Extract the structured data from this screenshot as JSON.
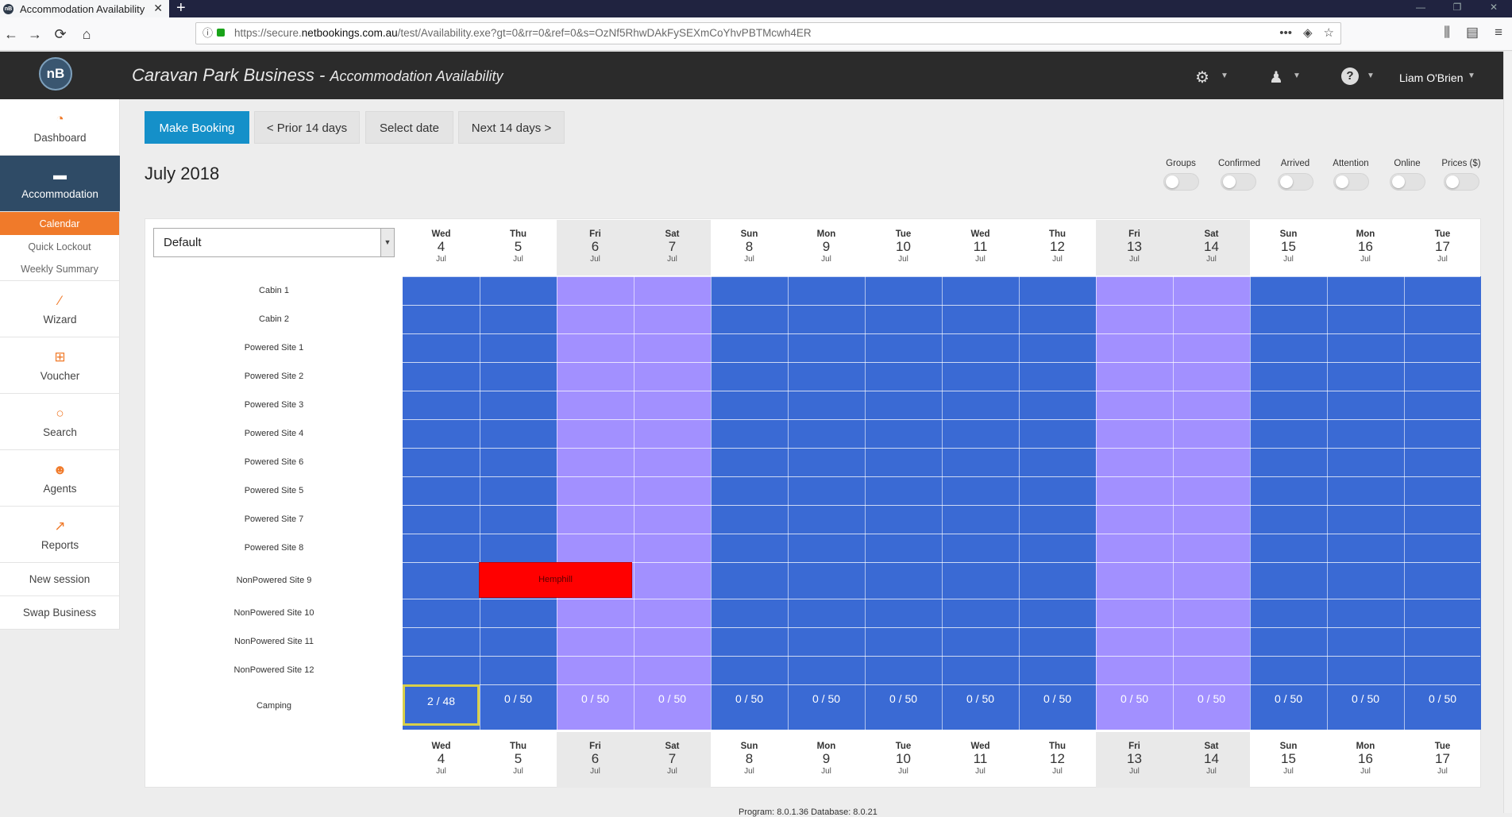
{
  "browser": {
    "tab_title": "Accommodation Availability",
    "favicon_text": "nB",
    "url_prefix": "https://secure.",
    "url_host": "netbookings.com.au",
    "url_rest": "/test/Availability.exe?gt=0&rr=0&ref=0&s=OzNf5RhwDAkFySEXmCoYhvPBTMcwh4ER"
  },
  "header": {
    "logo_text": "nB",
    "business": "Caravan Park Business",
    "separator": " - ",
    "page": "Accommodation Availability",
    "user": "Liam O'Brien"
  },
  "sidebar": {
    "dashboard": "Dashboard",
    "accommodation": "Accommodation",
    "calendar": "Calendar",
    "quick_lockout": "Quick Lockout",
    "weekly_summary": "Weekly Summary",
    "wizard": "Wizard",
    "voucher": "Voucher",
    "search": "Search",
    "agents": "Agents",
    "reports": "Reports",
    "new_session": "New session",
    "swap_business": "Swap Business"
  },
  "toolbar": {
    "make_booking": "Make Booking",
    "prior": "< Prior 14 days",
    "select_date": "Select date",
    "next": "Next 14 days >"
  },
  "month_title": "July 2018",
  "toggles": {
    "groups": "Groups",
    "confirmed": "Confirmed",
    "arrived": "Arrived",
    "attention": "Attention",
    "online": "Online",
    "prices": "Prices ($)"
  },
  "view_select": {
    "value": "Default"
  },
  "days": [
    {
      "dn": "Wed",
      "dd": "4",
      "dm": "Jul",
      "weekend": false
    },
    {
      "dn": "Thu",
      "dd": "5",
      "dm": "Jul",
      "weekend": false
    },
    {
      "dn": "Fri",
      "dd": "6",
      "dm": "Jul",
      "weekend": true
    },
    {
      "dn": "Sat",
      "dd": "7",
      "dm": "Jul",
      "weekend": true
    },
    {
      "dn": "Sun",
      "dd": "8",
      "dm": "Jul",
      "weekend": false
    },
    {
      "dn": "Mon",
      "dd": "9",
      "dm": "Jul",
      "weekend": false
    },
    {
      "dn": "Tue",
      "dd": "10",
      "dm": "Jul",
      "weekend": false
    },
    {
      "dn": "Wed",
      "dd": "11",
      "dm": "Jul",
      "weekend": false
    },
    {
      "dn": "Thu",
      "dd": "12",
      "dm": "Jul",
      "weekend": false
    },
    {
      "dn": "Fri",
      "dd": "13",
      "dm": "Jul",
      "weekend": true
    },
    {
      "dn": "Sat",
      "dd": "14",
      "dm": "Jul",
      "weekend": true
    },
    {
      "dn": "Sun",
      "dd": "15",
      "dm": "Jul",
      "weekend": false
    },
    {
      "dn": "Mon",
      "dd": "16",
      "dm": "Jul",
      "weekend": false
    },
    {
      "dn": "Tue",
      "dd": "17",
      "dm": "Jul",
      "weekend": false
    }
  ],
  "sites": [
    "Cabin 1",
    "Cabin 2",
    "Powered Site 1",
    "Powered Site 2",
    "Powered Site 3",
    "Powered Site 4",
    "Powered Site 6",
    "Powered Site 5",
    "Powered Site 7",
    "Powered Site 8",
    "NonPowered Site 9",
    "NonPowered Site 10",
    "NonPowered Site 11",
    "NonPowered Site 12"
  ],
  "camping": {
    "label": "Camping",
    "values": [
      "2 / 48",
      "0 / 50",
      "0 / 50",
      "0 / 50",
      "0 / 50",
      "0 / 50",
      "0 / 50",
      "0 / 50",
      "0 / 50",
      "0 / 50",
      "0 / 50",
      "0 / 50",
      "0 / 50",
      "0 / 50"
    ]
  },
  "booking": {
    "guest": "Hemphill"
  },
  "footer": {
    "version": "Program: 8.0.1.36 Database: 8.0.21"
  },
  "colors": {
    "weekday_cell": "#3a6ad4",
    "weekend_cell": "#a290ff",
    "booking": "#ff0000",
    "accent": "#f07a2a",
    "primary_button": "#1590c9"
  }
}
